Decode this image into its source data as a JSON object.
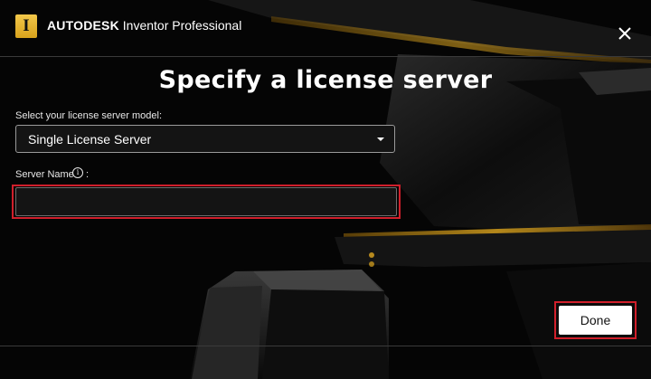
{
  "window": {
    "brand": "AUTODESK",
    "product": "Inventor Professional",
    "close_icon": "close-icon",
    "logo_letter": "I"
  },
  "page": {
    "title": "Specify a license server"
  },
  "form": {
    "model_label": "Select your license server model:",
    "model_selected": "Single License Server",
    "server_name_label": "Server Name",
    "server_name_suffix": ":",
    "server_name_value": "",
    "info_icon": "info-icon"
  },
  "footer": {
    "done_label": "Done"
  },
  "colors": {
    "accent_gold": "#e0a820",
    "highlight_red": "#d01f2b",
    "background": "#050505"
  }
}
